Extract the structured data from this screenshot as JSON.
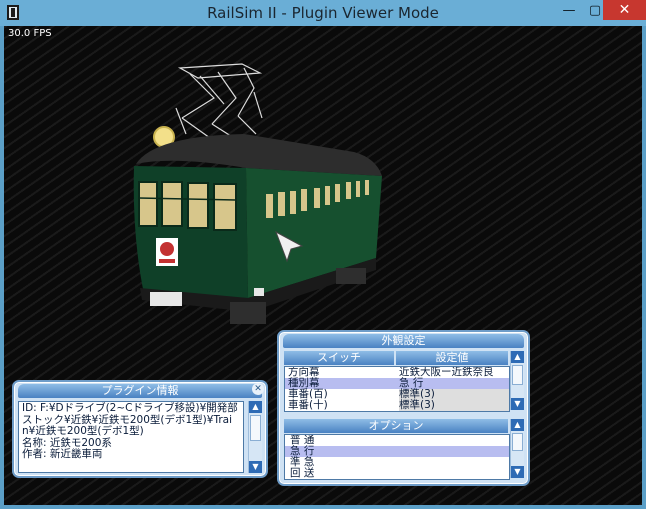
{
  "window": {
    "title": "RailSim II - Plugin Viewer Mode",
    "minimize": "—",
    "maximize": "▢",
    "close": "✕"
  },
  "viewport": {
    "fps": "30.0 FPS"
  },
  "plugin_info": {
    "title": "プラグイン情報",
    "close": "✕",
    "lines": [
      "ID: F:¥Dドライブ(2~Cドライブ移設)¥開発部",
      "ストック¥近鉄¥近鉄モ200型(デボ1型)¥Trai",
      "n¥近鉄モ200型(デボ1型)",
      "名称: 近鉄モ200系",
      "作者: 新近畿車両"
    ]
  },
  "appearance": {
    "title": "外観設定",
    "headers": {
      "switch": "スイッチ",
      "value": "設定値"
    },
    "switches": [
      {
        "name": "方向幕",
        "value": "近鉄大阪ー近鉄奈良"
      },
      {
        "name": "種別幕",
        "value": "急 行"
      },
      {
        "name": "車番(百)",
        "value": "標準(3)"
      },
      {
        "name": "車番(十)",
        "value": "標準(3)"
      }
    ],
    "option_header": "オプション",
    "options": [
      "普 通",
      "急 行",
      "準 急",
      "回 送"
    ]
  }
}
